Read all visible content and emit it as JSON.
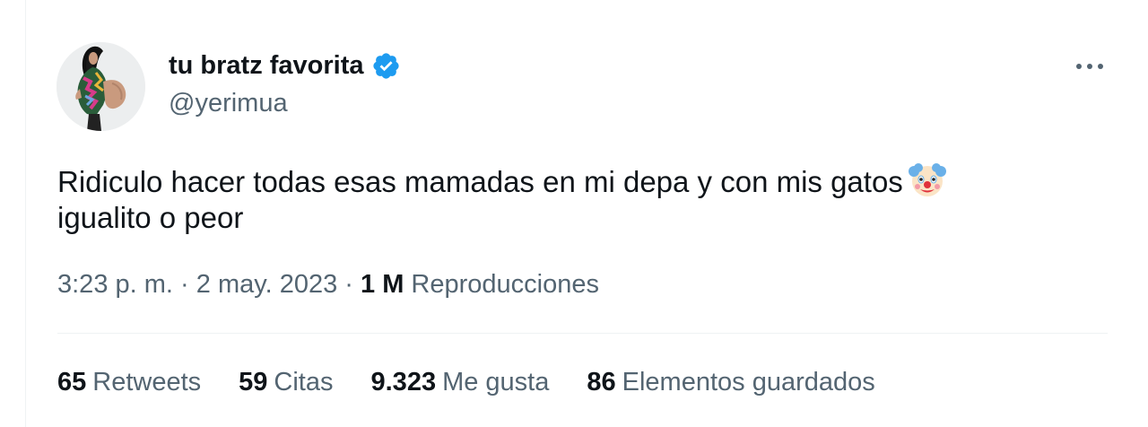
{
  "author": {
    "display_name": "tu bratz favorita",
    "handle": "@yerimua",
    "verified": true
  },
  "tweet": {
    "text_line1": "Ridiculo hacer todas esas mamadas en mi depa y con mis gatos",
    "emoji": "clown-face",
    "text_line2": "igualito o peor"
  },
  "meta": {
    "time": "3:23 p. m.",
    "sep1": "·",
    "date": "2 may. 2023",
    "sep2": "·",
    "views_count": "1 M",
    "views_label": "Reproducciones"
  },
  "stats": [
    {
      "count": "65",
      "label": "Retweets"
    },
    {
      "count": "59",
      "label": "Citas"
    },
    {
      "count": "9.323",
      "label": "Me gusta"
    },
    {
      "count": "86",
      "label": "Elementos guardados"
    }
  ],
  "colors": {
    "text_primary": "#0f1419",
    "text_secondary": "#536471",
    "verified_blue": "#1d9bf0",
    "divider": "#eff3f4"
  },
  "icons": {
    "verified": "verified-badge-icon",
    "more": "more-options-icon",
    "emoji": "clown-face-icon"
  }
}
